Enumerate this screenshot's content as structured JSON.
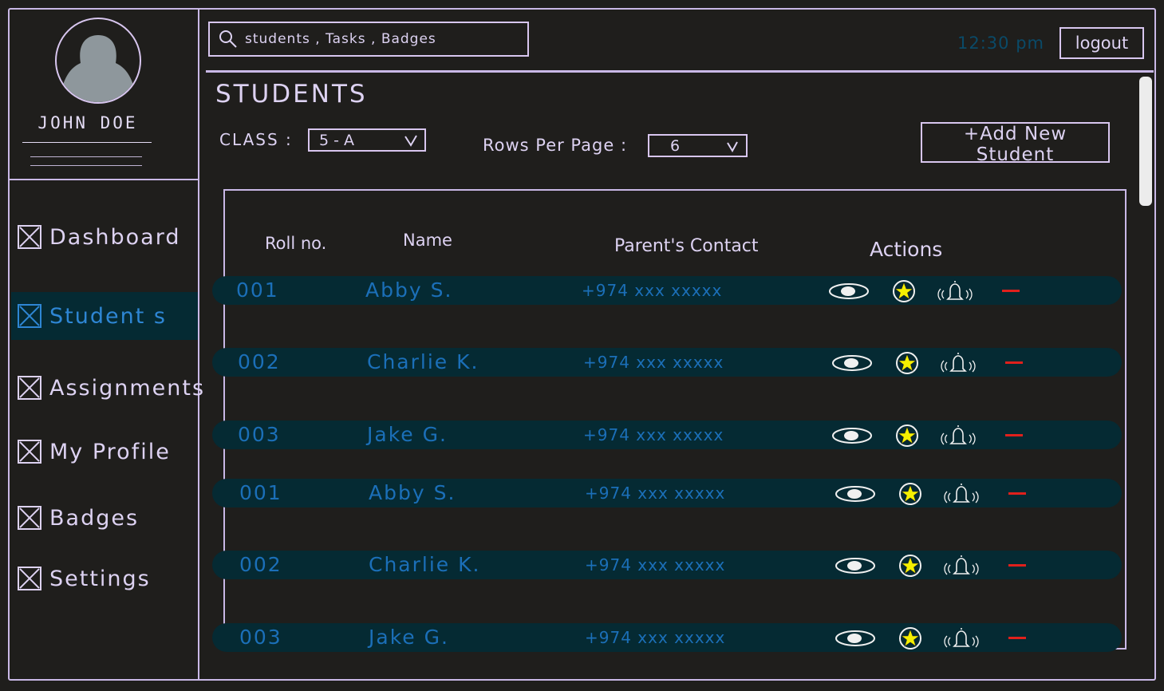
{
  "user": {
    "name": "JOHN DOE"
  },
  "sidebar": {
    "items": [
      {
        "label": "Dashboard",
        "active": false
      },
      {
        "label": "Student s",
        "active": true
      },
      {
        "label": "Assignments",
        "active": false
      },
      {
        "label": "My Profile",
        "active": false
      },
      {
        "label": "Badges",
        "active": false
      },
      {
        "label": "Settings",
        "active": false
      }
    ]
  },
  "header": {
    "search_placeholder": "students , Tasks , Badges",
    "time": "12:30 pm",
    "logout_label": "logout"
  },
  "page": {
    "title": "STUDENTS",
    "class_label": "CLASS :",
    "class_value": "5 - A",
    "rows_per_page_label": "Rows Per Page :",
    "rows_per_page_value": "6",
    "add_button_label": "+Add New Student"
  },
  "table": {
    "columns": [
      "Roll no.",
      "Name",
      "Parent's Contact",
      "Actions"
    ],
    "rows": [
      {
        "roll": "001",
        "name": "Abby S.",
        "contact": "+974 xxx xxxxx"
      },
      {
        "roll": "002",
        "name": "Charlie K.",
        "contact": "+974 xxx xxxxx"
      },
      {
        "roll": "003",
        "name": "Jake G.",
        "contact": "+974 xxx xxxxx"
      },
      {
        "roll": "001",
        "name": "Abby S.",
        "contact": "+974 xxx xxxxx"
      },
      {
        "roll": "002",
        "name": "Charlie K.",
        "contact": "+974 xxx xxxxx"
      },
      {
        "roll": "003",
        "name": "Jake G.",
        "contact": "+974 xxx xxxxx"
      }
    ],
    "actions": [
      "eye-icon",
      "star-icon",
      "bell-icon",
      "minus-icon"
    ]
  },
  "colors": {
    "outline": "#c9b8e6",
    "row_bg": "#052a33",
    "text_blue": "#1b6fb8",
    "star": "#f5f000",
    "delete": "#e0201c",
    "clock": "#0a4a68"
  }
}
